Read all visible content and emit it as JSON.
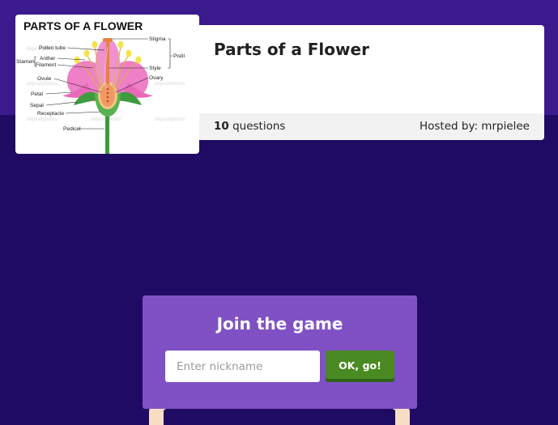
{
  "quiz": {
    "title": "Parts of a Flower",
    "question_count": "10",
    "question_label": "questions",
    "host_label": "Hosted by: mrpielee"
  },
  "diagram": {
    "title": "PARTS OF A FLOWER",
    "labels": {
      "pollen_tube": "Pollen tube",
      "stamen": "Stamen",
      "anther": "Anther",
      "filament": "Filament",
      "ovule": "Ovule",
      "petal": "Petal",
      "sepal": "Sepal",
      "receptacle": "Receptacle",
      "pedicel": "Pedicel",
      "stigma": "Stigma",
      "pistil": "Pistil",
      "style": "Style",
      "ovary": "Ovary"
    },
    "watermark": "depositphotos"
  },
  "join": {
    "title": "Join the game",
    "nickname_placeholder": "Enter nickname",
    "nickname_value": "",
    "submit_label": "OK, go!"
  },
  "colors": {
    "background": "#1f0b63",
    "top_band": "#3b1a8e",
    "join_panel": "#8051c5",
    "submit_button": "#4a8a23"
  }
}
